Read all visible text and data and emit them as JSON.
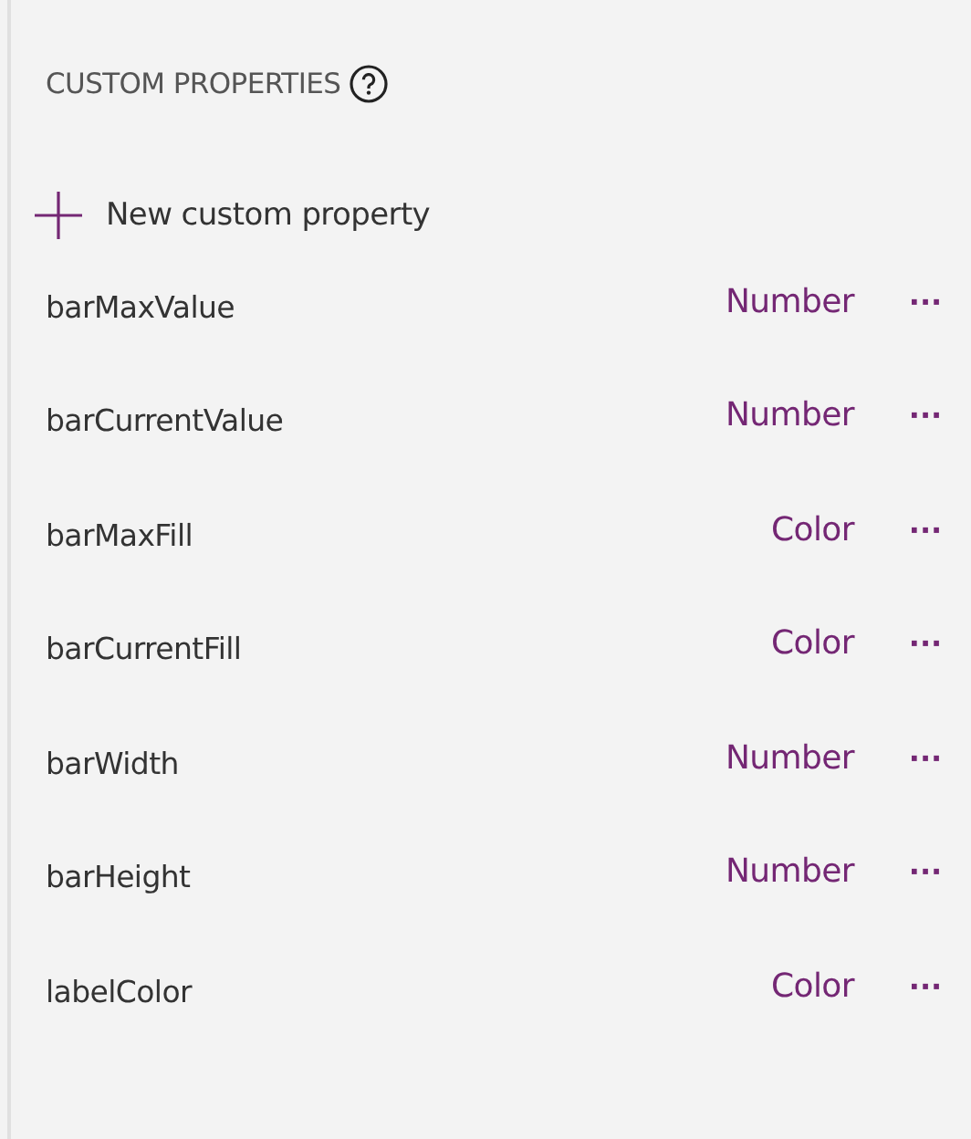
{
  "section": {
    "title": "CUSTOM PROPERTIES"
  },
  "add_button": {
    "label": "New custom property"
  },
  "properties": [
    {
      "name": "barMaxValue",
      "type": "Number",
      "more": "···"
    },
    {
      "name": "barCurrentValue",
      "type": "Number",
      "more": "···"
    },
    {
      "name": "barMaxFill",
      "type": "Color",
      "more": "···"
    },
    {
      "name": "barCurrentFill",
      "type": "Color",
      "more": "···"
    },
    {
      "name": "barWidth",
      "type": "Number",
      "more": "···"
    },
    {
      "name": "barHeight",
      "type": "Number",
      "more": "···"
    },
    {
      "name": "labelColor",
      "type": "Color",
      "more": "···"
    }
  ]
}
